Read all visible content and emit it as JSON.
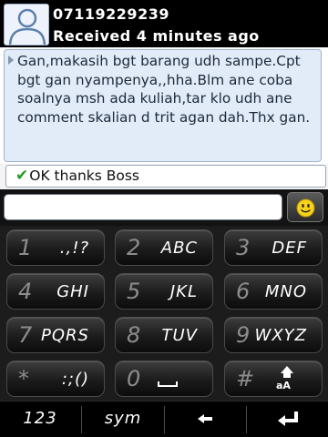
{
  "header": {
    "contact": "07119229239",
    "status": "Received 4 minutes ago",
    "avatar_icon": "person-silhouette-icon"
  },
  "conversation": {
    "received_message": "Gan,makasih bgt barang udh sampe.Cpt bgt gan nyampenya,,hha.Blm ane coba soalnya msh ada kuliah,tar klo udh ane comment skalian d trit agan dah.Thx gan.",
    "sent_message": "OK thanks Boss",
    "sent_icon": "checkmark-icon",
    "sent_check_color": "#1f9b1f"
  },
  "compose": {
    "value": "",
    "emoticon_icon": "smiley-icon"
  },
  "keypad": {
    "keys": [
      {
        "num": "1",
        "label": ".,!?"
      },
      {
        "num": "2",
        "label": "ABC"
      },
      {
        "num": "3",
        "label": "DEF"
      },
      {
        "num": "4",
        "label": "GHI"
      },
      {
        "num": "5",
        "label": "JKL"
      },
      {
        "num": "6",
        "label": "MNO"
      },
      {
        "num": "7",
        "label": "PQRS"
      },
      {
        "num": "8",
        "label": "TUV"
      },
      {
        "num": "9",
        "label": "WXYZ"
      },
      {
        "num": "*",
        "label": ":;()"
      },
      {
        "num": "0",
        "label": ""
      },
      {
        "num": "#",
        "label": ""
      }
    ],
    "space_icon": "space-icon",
    "shift_icon": "shift-icon",
    "shift_label": "aA"
  },
  "bottom_bar": {
    "numbers_label": "123",
    "symbols_label": "sym",
    "backspace_icon": "backspace-icon",
    "enter_icon": "enter-icon"
  }
}
